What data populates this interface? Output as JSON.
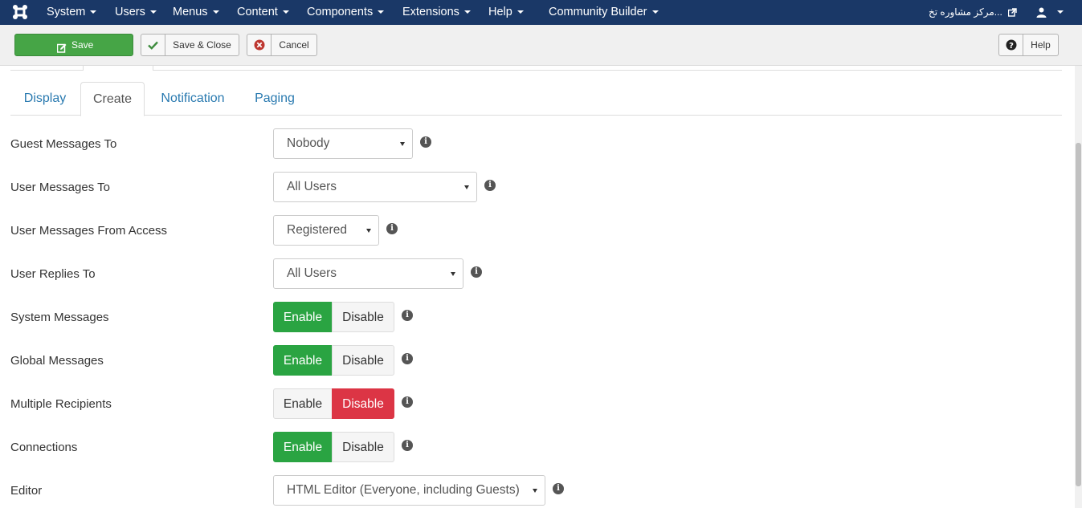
{
  "topnav": {
    "logo_icon": "joomla-logo-icon",
    "menus": [
      "System",
      "Users",
      "Menus",
      "Content",
      "Components",
      "Extensions",
      "Help",
      "Community Builder"
    ],
    "site_link": "...مرکز مشاوره تخ",
    "user_icon": "user-icon"
  },
  "toolbar": {
    "save_label": "Save",
    "save_close_label": "Save & Close",
    "cancel_label": "Cancel",
    "help_label": "Help"
  },
  "tabs": [
    "Display",
    "Create",
    "Notification",
    "Paging"
  ],
  "active_tab": "Create",
  "fields": {
    "guest_messages_to": {
      "label": "Guest Messages To",
      "value": "Nobody"
    },
    "user_messages_to": {
      "label": "User Messages To",
      "value": "All Users"
    },
    "user_messages_from_access": {
      "label": "User Messages From Access",
      "value": "Registered"
    },
    "user_replies_to": {
      "label": "User Replies To",
      "value": "All Users"
    },
    "system_messages": {
      "label": "System Messages",
      "enable": "Enable",
      "disable": "Disable",
      "selected": "Enable"
    },
    "global_messages": {
      "label": "Global Messages",
      "enable": "Enable",
      "disable": "Disable",
      "selected": "Enable"
    },
    "multiple_recipients": {
      "label": "Multiple Recipients",
      "enable": "Enable",
      "disable": "Disable",
      "selected": "Disable"
    },
    "connections": {
      "label": "Connections",
      "enable": "Enable",
      "disable": "Disable",
      "selected": "Enable"
    },
    "editor": {
      "label": "Editor",
      "value": "HTML Editor (Everyone, including Guests)"
    }
  },
  "colors": {
    "navbar": "#1a3867",
    "save_button": "#46a546",
    "toggle_enabled": "#2aa442",
    "toggle_disabled": "#dc3545",
    "link": "#2a7ab0"
  }
}
